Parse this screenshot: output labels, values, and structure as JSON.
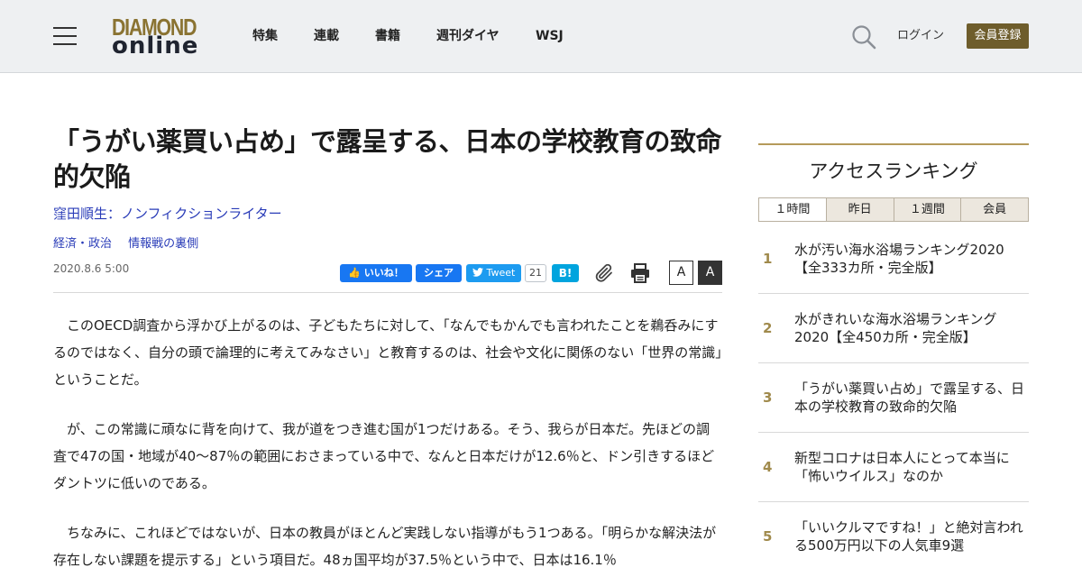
{
  "header": {
    "logo_top": "DIAMOND",
    "logo_bottom": "online",
    "nav": [
      "特集",
      "連載",
      "書籍",
      "週刊ダイヤ",
      "WSJ"
    ],
    "login_label": "ログイン",
    "register_label": "会員登録"
  },
  "article": {
    "title": "「うがい薬買い占め」で露呈する、日本の学校教育の致命的欠陥",
    "author": "窪田順生：ノンフィクションライター",
    "tags": [
      "経済・政治",
      "情報戦の裏側"
    ],
    "date": "2020.8.6 5:00",
    "paragraphs": [
      "このOECD調査から浮かび上がるのは、子どもたちに対して、「なんでもかんでも言われたことを鵜呑みにするのではなく、自分の頭で論理的に考えてみなさい」と教育するのは、社会や文化に関係のない「世界の常識」ということだ。",
      "が、この常識に頑なに背を向けて、我が道をつき進む国が1つだけある。そう、我らが日本だ。先ほどの調査で47の国・地域が40〜87％の範囲におさまっている中で、なんと日本だけが12.6％と、ドン引きするほどダントツに低いのである。",
      "ちなみに、これほどではないが、日本の教員がほとんど実践しない指導がもう1つある。「明らかな解決法が存在しない課題を提示する」という項目だ。48ヵ国平均が37.5％という中で、日本は16.1％"
    ]
  },
  "share": {
    "like_label": "いいね！",
    "share_label": "シェア",
    "tweet_label": "Tweet",
    "tweet_count": "21",
    "hatena_label": "B!",
    "font_small": "A",
    "font_large": "A"
  },
  "ranking": {
    "title": "アクセスランキング",
    "tabs": [
      "１時間",
      "昨日",
      "１週間",
      "会員"
    ],
    "items": [
      {
        "num": "1",
        "text": "水が汚い海水浴場ランキング2020【全333カ所・完全版】"
      },
      {
        "num": "2",
        "text": "水がきれいな海水浴場ランキング2020【全450カ所・完全版】"
      },
      {
        "num": "3",
        "text": "「うがい薬買い占め」で露呈する、日本の学校教育の致命的欠陥"
      },
      {
        "num": "4",
        "text": "新型コロナは日本人にとって本当に「怖いウイルス」なのか"
      },
      {
        "num": "5",
        "text": "「いいクルマですね！」と絶対言われる500万円以下の人気車9選"
      }
    ]
  },
  "colors": {
    "brand_gold": "#8a7332",
    "register_bg": "#6e5d2c",
    "link_blue": "#2a3cb8",
    "facebook": "#1877f2",
    "twitter": "#1d9bf0",
    "hatena": "#00a4de"
  }
}
